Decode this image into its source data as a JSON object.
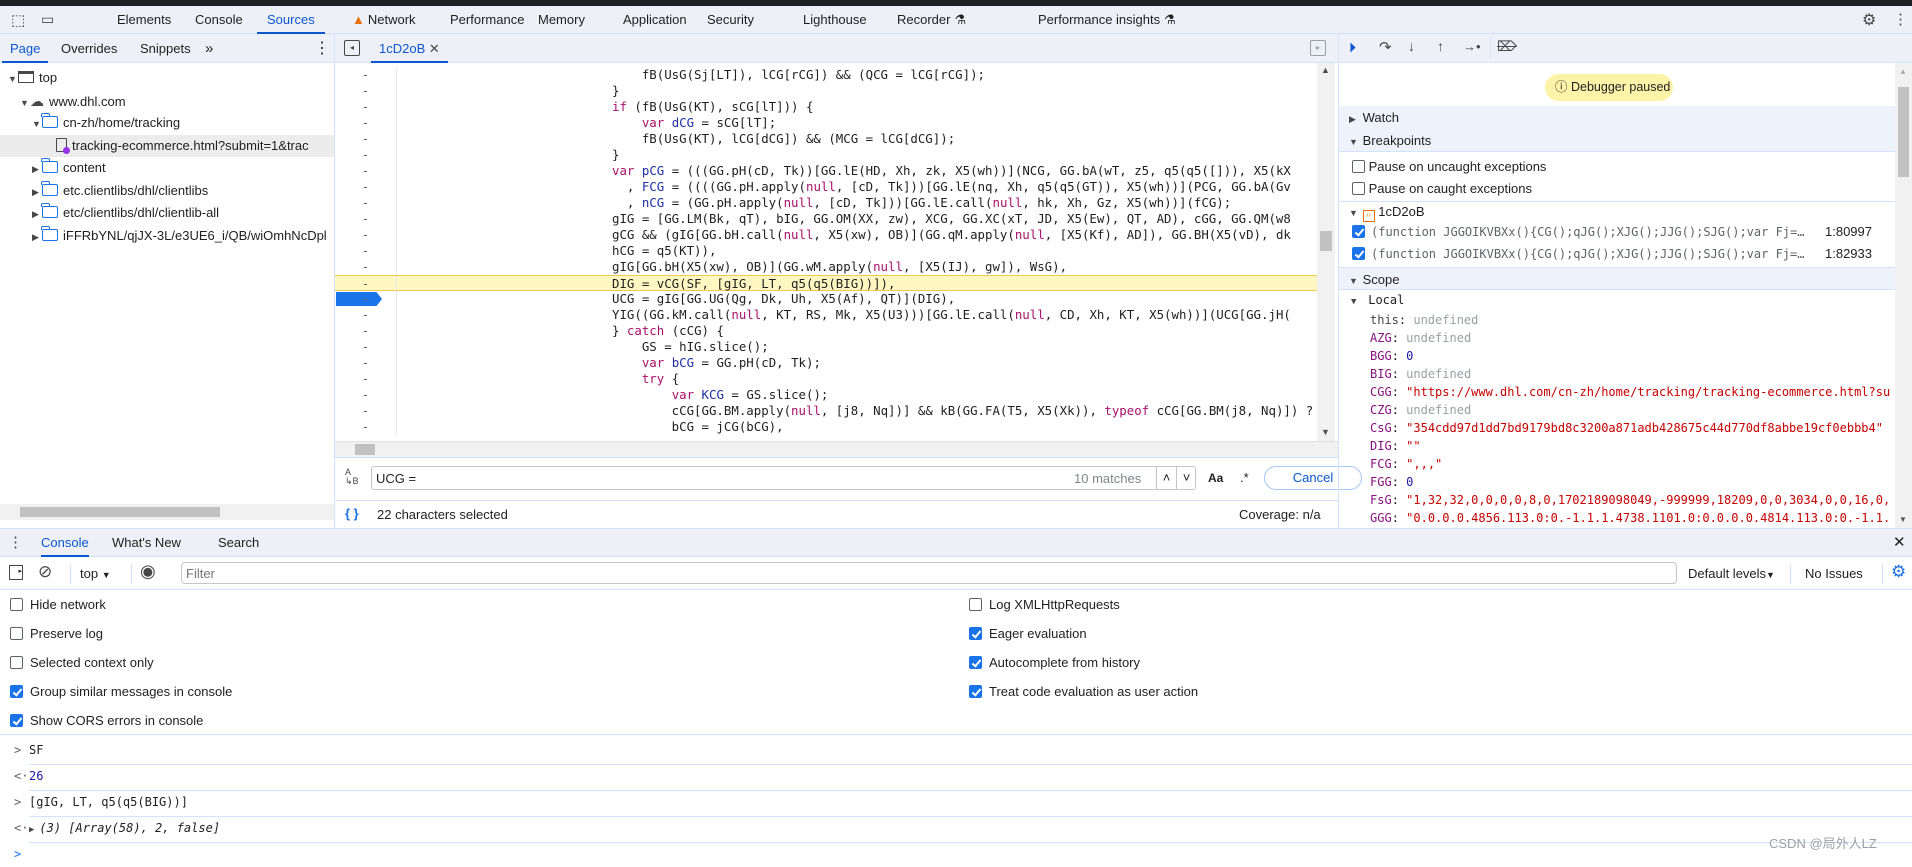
{
  "main_tabs": [
    {
      "label": "Elements"
    },
    {
      "label": "Console"
    },
    {
      "label": "Sources",
      "active": true
    },
    {
      "label": "Network",
      "warning": true
    },
    {
      "label": "Performance"
    },
    {
      "label": "Memory"
    },
    {
      "label": "Application"
    },
    {
      "label": "Security"
    },
    {
      "label": "Lighthouse"
    },
    {
      "label": "Recorder",
      "experimental": true
    },
    {
      "label": "Performance insights",
      "experimental": true
    }
  ],
  "navigator": {
    "tabs": [
      "Page",
      "Overrides",
      "Snippets"
    ],
    "more": "»",
    "tree": [
      {
        "label": "top",
        "icon": "frame-icon",
        "depth": 0,
        "expanded": true
      },
      {
        "label": "www.dhl.com",
        "icon": "cloud-icon",
        "depth": 1,
        "expanded": true
      },
      {
        "label": "cn-zh/home/tracking",
        "icon": "folder-icon",
        "depth": 2,
        "expanded": true
      },
      {
        "label": "tracking-ecommerce.html?submit=1&trac",
        "icon": "file-icon",
        "depth": 3,
        "selected": true
      },
      {
        "label": "content",
        "icon": "folder-icon",
        "depth": 2,
        "expanded": false
      },
      {
        "label": "etc.clientlibs/dhl/clientlibs",
        "icon": "folder-icon",
        "depth": 2,
        "expanded": false
      },
      {
        "label": "etc/clientlibs/dhl/clientlib-all",
        "icon": "folder-icon",
        "depth": 2,
        "expanded": false
      },
      {
        "label": "iFFRbYNL/qjJX-3L/e3UE6_i/QB/wiOmhNcDpl",
        "icon": "folder-icon",
        "depth": 2,
        "expanded": false
      }
    ]
  },
  "editor": {
    "file_tab": "1cD2oB",
    "gutter_mark": "-",
    "lines": [
      "    fB(UsG(Sj[LT]), lCG[rCG]) && (QCG = lCG[rCG]);",
      "}",
      "if (fB(UsG(KT), sCG[lT])) {",
      "    var dCG = sCG[lT];",
      "    fB(UsG(KT), lCG[dCG]) && (MCG = lCG[dCG]);",
      "}",
      "var pCG = (((GG.pH(cD, Tk))[GG.lE(HD, Xh, zk, X5(wh))](NCG, GG.bA(wT, z5, q5(q5([])), X5(kX",
      "  , FCG = ((((GG.pH.apply(null, [cD, Tk]))[GG.lE(nq, Xh, q5(q5(GT)), X5(wh))](PCG, GG.bA(Gv",
      "  , nCG = (GG.pH.apply(null, [cD, Tk]))[GG.lE.call(null, hk, Xh, Gz, X5(wh))](fCG);",
      "gIG = [GG.LM(Bk, qT), bIG, GG.OM(XX, zw), XCG, GG.XC(xT, JD, X5(Ew), QT, AD), cGG, GG.QM(w8",
      "gCG && (gIG[GG.bH.call(null, X5(xw), OB)](GG.qM.apply(null, [X5(Kf), AD]), GG.BH(X5(vD), dk",
      "hCG = q5(KT)),",
      "gIG[GG.bH(X5(xw), OB)](GG.wM.apply(null, [X5(IJ), gw]), WsG),",
      "DIG = vCG(SF, [gIG, LT, q5(q5(BIG))]),",
      "UCG = gIG[GG.UG(Qg, Dk, Uh, X5(Af), QT)](DIG),",
      "YIG((GG.kM.call(null, KT, RS, Mk, X5(U3)))[GG.lE.call(null, CD, Xh, KT, X5(wh))](UCG[GG.jH(",
      "} catch (cCG) {",
      "    GS = hIG.slice();",
      "    var bCG = GG.pH(cD, Tk);",
      "    try {",
      "        var KCG = GS.slice();",
      "        cCG[GG.BM.apply(null, [j8, Nq])] && kB(GG.FA(T5, X5(Xk)), typeof cCG[GG.BM(j8, Nq)]) ?",
      "        bCG = jCG(bCG),"
    ],
    "indent_levels": [
      2,
      1,
      1,
      2,
      2,
      1,
      1,
      1,
      1,
      1,
      1,
      1,
      1,
      1,
      1,
      1,
      0,
      0,
      0,
      0,
      0,
      0,
      0
    ],
    "paused_line": 13,
    "breakpoint_line": 14
  },
  "search": {
    "query": "UCG =",
    "matches": "10 matches",
    "case_label": "Aa",
    "regex_label": ".*",
    "cancel": "Cancel"
  },
  "status": {
    "format_icon": "{ }",
    "selection": "22 characters selected",
    "coverage": "Coverage: n/a"
  },
  "debugger": {
    "paused_banner": "Debugger paused",
    "watch": "Watch",
    "breakpoints": "Breakpoints",
    "pause_uncaught": "Pause on uncaught exceptions",
    "pause_caught": "Pause on caught exceptions",
    "bp_file": "1cD2oB",
    "bp_items": [
      {
        "code": "(function JGGOIKVBXx(){CG();qJG();XJG();JJG();SJG();var Fj=…",
        "location": "1:80997",
        "checked": true
      },
      {
        "code": "(function JGGOIKVBXx(){CG();qJG();XJG();JJG();SJG();var Fj=…",
        "location": "1:82933",
        "checked": true
      }
    ],
    "scope": "Scope",
    "local": "Local",
    "vars": [
      {
        "name": "this",
        "value": "undefined",
        "kind": "u"
      },
      {
        "name": "AZG",
        "value": "undefined",
        "kind": "u"
      },
      {
        "name": "BGG",
        "value": "0",
        "kind": "num"
      },
      {
        "name": "BIG",
        "value": "undefined",
        "kind": "u"
      },
      {
        "name": "CGG",
        "value": "\"https://www.dhl.com/cn-zh/home/tracking/tracking-ecommerce.html?su",
        "kind": "s"
      },
      {
        "name": "CZG",
        "value": "undefined",
        "kind": "u"
      },
      {
        "name": "CsG",
        "value": "\"354cdd97d1dd7bd9179bd8c3200a871adb428675c44d770df8abbe19cf0ebbb4\"",
        "kind": "s"
      },
      {
        "name": "DIG",
        "value": "\"\"",
        "kind": "s"
      },
      {
        "name": "FCG",
        "value": "\",,,\"",
        "kind": "s"
      },
      {
        "name": "FGG",
        "value": "0",
        "kind": "num"
      },
      {
        "name": "FsG",
        "value": "\"1,32,32,0,0,0,0,8,0,1702189098049,-999999,18209,0,0,3034,0,0,16,0,",
        "kind": "s"
      },
      {
        "name": "GGG",
        "value": "\"0.0.0.0.4856.113.0:0.-1.1.1.4738.1101.0:0.0.0.0.4814.113.0:0.-1.1.",
        "kind": "s"
      }
    ]
  },
  "drawer": {
    "tabs": [
      "Console",
      "What's New",
      "Search"
    ],
    "context": "top",
    "filter_placeholder": "Filter",
    "levels": "Default levels",
    "issues": "No Issues",
    "settings_left": [
      {
        "label": "Hide network",
        "checked": false
      },
      {
        "label": "Preserve log",
        "checked": false
      },
      {
        "label": "Selected context only",
        "checked": false
      },
      {
        "label": "Group similar messages in console",
        "checked": true
      },
      {
        "label": "Show CORS errors in console",
        "checked": true
      }
    ],
    "settings_right": [
      {
        "label": "Log XMLHttpRequests",
        "checked": false
      },
      {
        "label": "Eager evaluation",
        "checked": true
      },
      {
        "label": "Autocomplete from history",
        "checked": true
      },
      {
        "label": "Treat code evaluation as user action",
        "checked": true
      }
    ],
    "messages": [
      {
        "type": "input",
        "text": "SF"
      },
      {
        "type": "output",
        "text": "26"
      },
      {
        "type": "input",
        "text": "[gIG, LT, q5(q5(BIG))]"
      },
      {
        "type": "output",
        "text": "(3) [Array(58), 2, false]",
        "expandable": true
      }
    ],
    "prompt": ">"
  },
  "watermark": "CSDN @局外人LZ",
  "colors": {
    "accent": "#0b57d0",
    "paused_line": "#fff7c2",
    "banner": "#fdf3a8"
  }
}
